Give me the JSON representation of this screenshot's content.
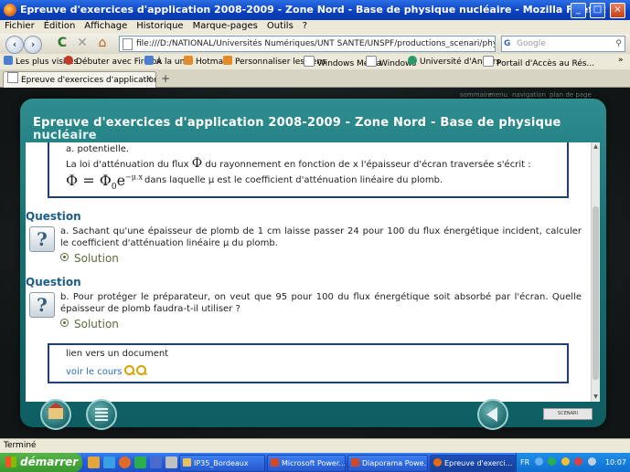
{
  "window": {
    "title": "Epreuve d'exercices d'application 2008-2009 - Zone Nord - Base de physique nucléaire - Mozilla Firefox",
    "btn_min": "_",
    "btn_max": "□",
    "btn_close": "×"
  },
  "menu": [
    "Fichier",
    "Édition",
    "Affichage",
    "Historique",
    "Marque-pages",
    "Outils",
    "?"
  ],
  "nav": {
    "back": "‹",
    "forward": "›",
    "reload": "C",
    "stop": "✕",
    "home": "⌂",
    "url": "file:///D:/NATIONAL/Universités Numériques/UNT SANTE/UNSPF/productions_scenari/physique_nucleaire_web_w",
    "search_placeholder": "Google",
    "search_icon": "search-icon"
  },
  "bookmarks": [
    "Les plus visités",
    "Débuter avec Firefox",
    "À la une",
    "Hotmail",
    "Personnaliser les liens",
    "Windows Media",
    "Windows",
    "Université d'Angers",
    "Portail d'Accès au Rés..."
  ],
  "bookmarks_more": "»",
  "tab": {
    "label": "Epreuve d'exercices d'application 20...",
    "close": "×",
    "new": "+"
  },
  "top_links": [
    "sommaire",
    "menu",
    "navigation",
    "plan de page"
  ],
  "page": {
    "title": "Epreuve d'exercices d'application 2008-2009 - Zone Nord - Base de physique",
    "title_overflow": "nucléaire",
    "partial_line": "a. potentielle.",
    "law_text_1": "La loi d'atténuation du flux",
    "law_phi": "Φ",
    "law_text_2": "du rayonnement en fonction de x l'épaisseur d'écran traversée s'écrit :",
    "formula_lhs": "Φ",
    "formula_eq": " = ",
    "formula_rhs": "Φ",
    "formula_sub": "0",
    "formula_e": "e",
    "formula_sup": "−μ.x",
    "formula_desc": "dans laquelle μ est le coefficient d'atténuation linéaire du plomb.",
    "questions": [
      {
        "label": "Question",
        "icon_glyph": "?",
        "text": "a. Sachant qu'une épaisseur de plomb de 1 cm laisse passer 24 pour 100 du flux énergétique incident, calculer le coefficient d'atténuation linéaire μ du plomb.",
        "solution": "Solution"
      },
      {
        "label": "Question",
        "icon_glyph": "?",
        "text": "b. Pour protéger le préparateur, on veut que 95 pour 100 du flux énergétique soit absorbé par l'écran. Quelle épaisseur de plomb faudra-t-il utiliser ?",
        "solution": "Solution"
      }
    ],
    "doc_box_title": "lien vers un document",
    "doc_link": "voir le cours",
    "logo_badge": "SCENARI",
    "scroll_up": "▲",
    "scroll_down": "▼"
  },
  "status": "Terminé",
  "taskbar": {
    "start": "démarrer",
    "tasks": [
      "IP35_Bordeaux",
      "Microsoft Power...",
      "Diaporama Powe...",
      "Epreuve d'exerci..."
    ],
    "lang": "FR",
    "clock": "10:07"
  }
}
